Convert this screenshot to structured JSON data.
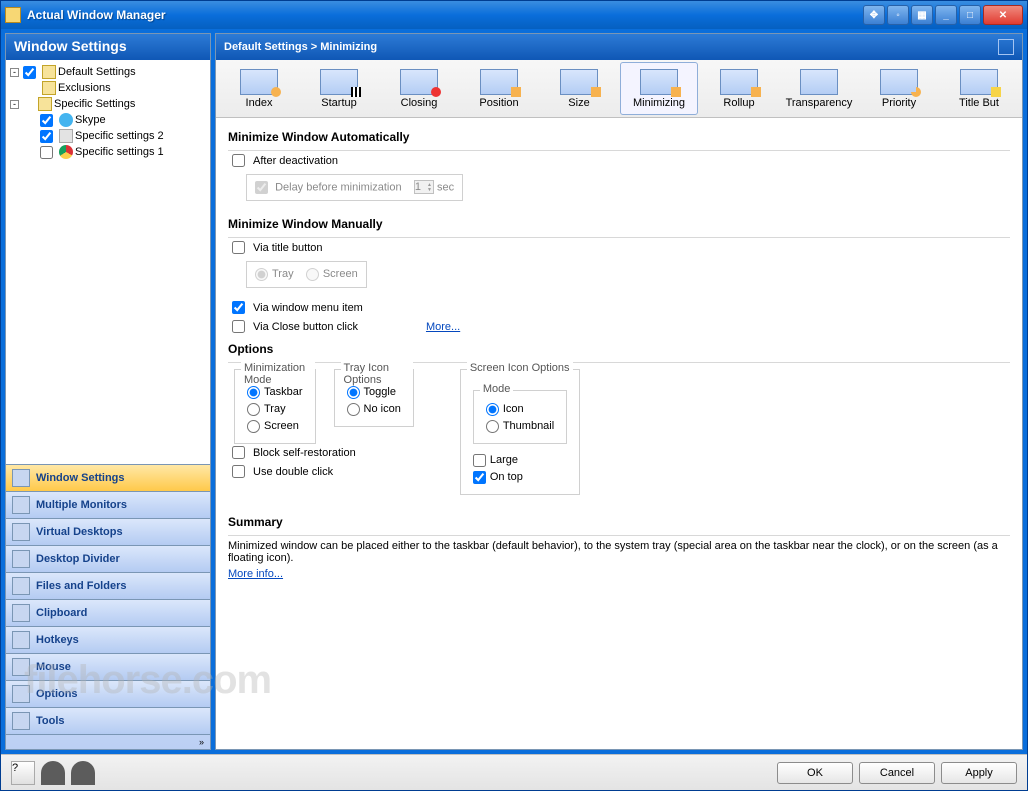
{
  "window": {
    "title": "Actual Window Manager"
  },
  "titlebar_buttons": [
    "move",
    "pin",
    "tile",
    "min",
    "max"
  ],
  "sidebar": {
    "header": "Window Settings",
    "tree": {
      "default": {
        "label": "Default Settings",
        "checked": true
      },
      "exclusions": {
        "label": "Exclusions"
      },
      "specific": {
        "label": "Specific Settings",
        "expanded": "-",
        "items": [
          {
            "label": "Skype",
            "checked": true,
            "icon": "skype"
          },
          {
            "label": "Specific settings 2",
            "checked": true,
            "icon": "app"
          },
          {
            "label": "Specific settings 1",
            "checked": false,
            "icon": "chrome"
          }
        ]
      }
    },
    "nav": [
      {
        "label": "Window Settings",
        "active": true
      },
      {
        "label": "Multiple Monitors"
      },
      {
        "label": "Virtual Desktops"
      },
      {
        "label": "Desktop Divider"
      },
      {
        "label": "Files and Folders"
      },
      {
        "label": "Clipboard"
      },
      {
        "label": "Hotkeys"
      },
      {
        "label": "Mouse"
      },
      {
        "label": "Options"
      },
      {
        "label": "Tools"
      }
    ]
  },
  "main": {
    "breadcrumb": "Default Settings > Minimizing",
    "tabs": [
      {
        "label": "Index"
      },
      {
        "label": "Startup"
      },
      {
        "label": "Closing"
      },
      {
        "label": "Position"
      },
      {
        "label": "Size"
      },
      {
        "label": "Minimizing",
        "active": true
      },
      {
        "label": "Rollup"
      },
      {
        "label": "Transparency"
      },
      {
        "label": "Priority"
      },
      {
        "label": "Title But"
      }
    ],
    "auto": {
      "title": "Minimize Window Automatically",
      "after_deactivation": {
        "label": "After deactivation",
        "checked": false
      },
      "delay_label": "Delay before minimization",
      "delay_value": "1",
      "delay_unit": "sec"
    },
    "manual": {
      "title": "Minimize Window Manually",
      "via_title": {
        "label": "Via title button",
        "checked": false
      },
      "radio_tray": "Tray",
      "radio_screen": "Screen",
      "via_menu": {
        "label": "Via window menu item",
        "checked": true
      },
      "via_close": {
        "label": "Via Close button click",
        "checked": false
      },
      "more": "More..."
    },
    "options": {
      "title": "Options",
      "minimization_mode": {
        "legend": "Minimization Mode",
        "taskbar": "Taskbar",
        "tray": "Tray",
        "screen": "Screen",
        "selected": "taskbar"
      },
      "tray_icon": {
        "legend": "Tray Icon Options",
        "toggle": "Toggle",
        "noicon": "No icon",
        "selected": "toggle"
      },
      "screen_icon": {
        "legend": "Screen Icon Options",
        "mode_legend": "Mode",
        "icon": "Icon",
        "thumbnail": "Thumbnail",
        "selected": "icon",
        "large": {
          "label": "Large",
          "checked": false
        },
        "on_top": {
          "label": "On top",
          "checked": true
        }
      },
      "block_self": {
        "label": "Block self-restoration",
        "checked": false
      },
      "use_double": {
        "label": "Use double click",
        "checked": false
      }
    },
    "summary": {
      "title": "Summary",
      "text": "Minimized window can be placed either to the taskbar (default behavior), to the system tray (special area on the taskbar near the clock), or on the screen (as a floating icon).",
      "more": "More info..."
    }
  },
  "footer": {
    "ok": "OK",
    "cancel": "Cancel",
    "apply": "Apply"
  },
  "watermark": "filehorse.com"
}
